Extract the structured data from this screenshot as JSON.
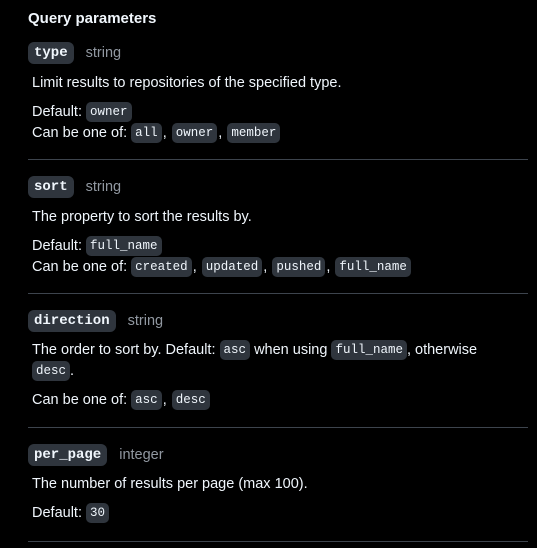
{
  "section_title": "Query parameters",
  "params": [
    {
      "name": "type",
      "type": "string",
      "description": "Limit results to repositories of the specified type.",
      "default_label": "Default:",
      "default": "owner",
      "options_label": "Can be one of:",
      "options": [
        "all",
        "owner",
        "member"
      ]
    },
    {
      "name": "sort",
      "type": "string",
      "description": "The property to sort the results by.",
      "default_label": "Default:",
      "default": "full_name",
      "options_label": "Can be one of:",
      "options": [
        "created",
        "updated",
        "pushed",
        "full_name"
      ]
    },
    {
      "name": "direction",
      "type": "string",
      "description_prefix": "The order to sort by. Default:",
      "code_1": "asc",
      "description_mid": "when using",
      "code_2": "full_name",
      "description_suffix": ", otherwise",
      "code_3": "desc",
      "description_end": ".",
      "options_label": "Can be one of:",
      "options": [
        "asc",
        "desc"
      ]
    },
    {
      "name": "per_page",
      "type": "integer",
      "description": "The number of results per page (max 100).",
      "default_label": "Default:",
      "default": "30"
    }
  ]
}
